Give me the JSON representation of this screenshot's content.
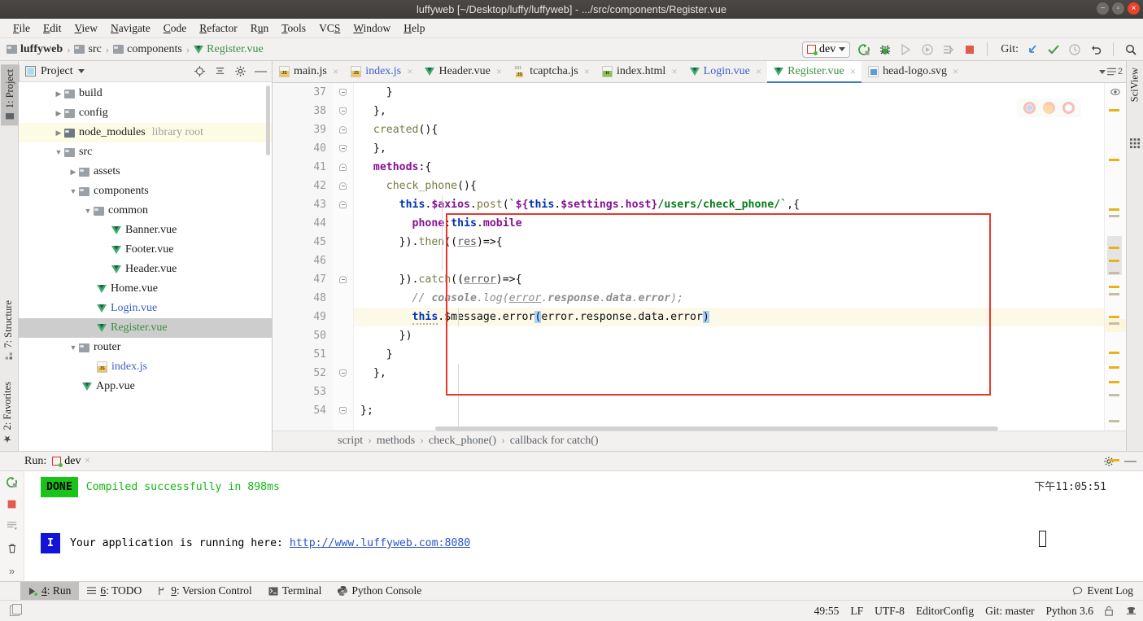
{
  "window": {
    "title": "luffyweb [~/Desktop/luffy/luffyweb] - .../src/components/Register.vue",
    "minimize_label": "–",
    "maximize_label": "□",
    "close_label": "×"
  },
  "menu": {
    "items": [
      "File",
      "Edit",
      "View",
      "Navigate",
      "Code",
      "Refactor",
      "Run",
      "Tools",
      "VCS",
      "Window",
      "Help"
    ]
  },
  "navbar": {
    "breadcrumbs": [
      {
        "label": "luffyweb",
        "icon": "folder-icon",
        "type": "folder",
        "bold": true
      },
      {
        "label": "src",
        "icon": "folder-icon",
        "type": "folder",
        "bold": false
      },
      {
        "label": "components",
        "icon": "folder-icon",
        "type": "folder",
        "bold": false
      },
      {
        "label": "Register.vue",
        "icon": "vue-file-icon",
        "type": "vue",
        "bold": false
      }
    ],
    "run_config": "dev",
    "git_label": "Git:",
    "icons": [
      "rerun-icon",
      "debug-icon",
      "run-with-coverage-icon",
      "profile-icon",
      "step-icon",
      "stop-icon",
      "update-project-icon",
      "commit-icon",
      "history-icon",
      "rollback-icon",
      "search-everywhere-icon"
    ]
  },
  "left_tool_strip": {
    "tabs": [
      {
        "label": "1: Project",
        "selected": true
      },
      {
        "label": "7: Structure",
        "selected": false
      },
      {
        "label": "2: Favorites",
        "selected": false
      }
    ]
  },
  "right_tool_strip": {
    "tabs": [
      {
        "label": "SciView",
        "selected": false
      }
    ]
  },
  "project_panel": {
    "title": "Project",
    "header_icons": [
      "locate-icon",
      "collapse-all-icon",
      "settings-gear-icon",
      "hide-icon"
    ],
    "tree": [
      {
        "label": "build",
        "indent": 1,
        "arrow": "right",
        "icon": "folder-icon",
        "color": "default",
        "state": "normal",
        "sub": ""
      },
      {
        "label": "config",
        "indent": 1,
        "arrow": "right",
        "icon": "folder-icon",
        "color": "default",
        "state": "normal",
        "sub": ""
      },
      {
        "label": "node_modules",
        "indent": 1,
        "arrow": "right",
        "icon": "folder-dark-icon",
        "color": "default",
        "state": "highlight",
        "sub": "library root"
      },
      {
        "label": "src",
        "indent": 1,
        "arrow": "down",
        "icon": "folder-icon",
        "color": "default",
        "state": "normal",
        "sub": ""
      },
      {
        "label": "assets",
        "indent": 2,
        "arrow": "right",
        "icon": "folder-icon",
        "color": "default",
        "state": "normal",
        "sub": ""
      },
      {
        "label": "components",
        "indent": 2,
        "arrow": "down",
        "icon": "folder-icon",
        "color": "default",
        "state": "normal",
        "sub": ""
      },
      {
        "label": "common",
        "indent": 3,
        "arrow": "down",
        "icon": "folder-icon",
        "color": "default",
        "state": "normal",
        "sub": ""
      },
      {
        "label": "Banner.vue",
        "indent": 4,
        "arrow": "none",
        "icon": "vue-file-icon",
        "color": "default",
        "state": "normal",
        "sub": ""
      },
      {
        "label": "Footer.vue",
        "indent": 4,
        "arrow": "none",
        "icon": "vue-file-icon",
        "color": "default",
        "state": "normal",
        "sub": ""
      },
      {
        "label": "Header.vue",
        "indent": 4,
        "arrow": "none",
        "icon": "vue-file-icon",
        "color": "default",
        "state": "normal",
        "sub": ""
      },
      {
        "label": "Home.vue",
        "indent": 3,
        "arrow": "none",
        "icon": "vue-file-icon",
        "color": "default",
        "state": "normal",
        "sub": ""
      },
      {
        "label": "Login.vue",
        "indent": 3,
        "arrow": "none",
        "icon": "vue-file-icon",
        "color": "blue",
        "state": "normal",
        "sub": ""
      },
      {
        "label": "Register.vue",
        "indent": 3,
        "arrow": "none",
        "icon": "vue-file-icon",
        "color": "green",
        "state": "selected",
        "sub": ""
      },
      {
        "label": "router",
        "indent": 2,
        "arrow": "down",
        "icon": "folder-icon",
        "color": "default",
        "state": "normal",
        "sub": ""
      },
      {
        "label": "index.js",
        "indent": 3,
        "arrow": "none",
        "icon": "js-file-icon",
        "color": "blue",
        "state": "normal",
        "sub": ""
      },
      {
        "label": "App.vue",
        "indent": 2,
        "arrow": "none",
        "icon": "vue-file-icon",
        "color": "default",
        "state": "normal",
        "sub": ""
      }
    ]
  },
  "editor_tabs": [
    {
      "label": "main.js",
      "icon": "js-file-icon",
      "color": "default",
      "active": false,
      "close": "×"
    },
    {
      "label": "index.js",
      "icon": "js-file-icon",
      "color": "blue",
      "active": false,
      "close": "×"
    },
    {
      "label": "Header.vue",
      "icon": "vue-file-icon",
      "color": "default",
      "active": false,
      "close": "×"
    },
    {
      "label": "tcaptcha.js",
      "icon": "ts-file-icon",
      "color": "default",
      "active": false,
      "close": "×"
    },
    {
      "label": "index.html",
      "icon": "html-file-icon",
      "color": "default",
      "active": false,
      "close": "×"
    },
    {
      "label": "Login.vue",
      "icon": "vue-file-icon",
      "color": "blue",
      "active": false,
      "close": "×"
    },
    {
      "label": "Register.vue",
      "icon": "vue-file-icon",
      "color": "green",
      "active": true,
      "close": "×"
    },
    {
      "label": "head-logo.svg",
      "icon": "svg-file-icon",
      "color": "default",
      "active": false,
      "close": "×"
    }
  ],
  "editor_tabs_overflow": "2",
  "code": {
    "first_line": 37,
    "highlight_line": 49,
    "lines": [
      {
        "n": 37,
        "fold": "end",
        "text": "    }"
      },
      {
        "n": 38,
        "fold": "end",
        "text": "  },"
      },
      {
        "n": 39,
        "fold": "start",
        "text": "  created(){"
      },
      {
        "n": 40,
        "fold": "end",
        "text": "  },"
      },
      {
        "n": 41,
        "fold": "start",
        "text": "  methods:{"
      },
      {
        "n": 42,
        "fold": "start",
        "text": "    check_phone(){"
      },
      {
        "n": 43,
        "fold": "start",
        "text": "      this.$axios.post(`${this.$settings.host}/users/check_phone/`,{"
      },
      {
        "n": 44,
        "fold": "none",
        "text": "        phone:this.mobile"
      },
      {
        "n": 45,
        "fold": "none",
        "text": "      }).then((res)=>{"
      },
      {
        "n": 46,
        "fold": "none",
        "text": ""
      },
      {
        "n": 47,
        "fold": "start",
        "text": "      }).catch((error)=>{"
      },
      {
        "n": 48,
        "fold": "none",
        "text": "        // console.log(error.response.data.error);"
      },
      {
        "n": 49,
        "fold": "none",
        "text": "        this.$message.error(error.response.data.error)"
      },
      {
        "n": 50,
        "fold": "none",
        "text": "      })"
      },
      {
        "n": 51,
        "fold": "none",
        "text": "    }"
      },
      {
        "n": 52,
        "fold": "end",
        "text": "  },"
      },
      {
        "n": 53,
        "fold": "none",
        "text": ""
      },
      {
        "n": 54,
        "fold": "end",
        "text": "};"
      }
    ]
  },
  "editor_breadcrumb": {
    "items": [
      "script",
      "methods",
      "check_phone()",
      "callback for catch()"
    ],
    "separator": "›"
  },
  "run_panel": {
    "label": "Run:",
    "config": "dev",
    "close": "×",
    "settings_icon": "gear-icon",
    "hide_icon": "hide-icon",
    "timestamp": "下午11:05:51",
    "lines": [
      {
        "badge": "DONE",
        "badge_type": "done",
        "text": "Compiled successfully in 898ms"
      },
      {
        "badge": "I",
        "badge_type": "info",
        "text": "Your application is running here: ",
        "link": "http://www.luffyweb.com:8080"
      }
    ],
    "tool_icons": [
      "rerun-icon",
      "stop-icon",
      "scroll-to-end-icon",
      "trash-icon"
    ]
  },
  "bottom_tool_buttons": [
    {
      "label": "4: Run",
      "icon": "run-icon",
      "active": true
    },
    {
      "label": "6: TODO",
      "icon": "todo-icon",
      "active": false
    },
    {
      "label": "9: Version Control",
      "icon": "branch-icon",
      "active": false
    },
    {
      "label": "Terminal",
      "icon": "terminal-icon",
      "active": false
    },
    {
      "label": "Python Console",
      "icon": "python-icon",
      "active": false
    }
  ],
  "event_log": {
    "label": "Event Log",
    "icon": "balloon-icon"
  },
  "status_bar": {
    "position": "49:55",
    "line_separator": "LF",
    "encoding": "UTF-8",
    "editor_config": "EditorConfig",
    "git_branch": "Git: master",
    "interpreter": "Python 3.6",
    "icons": [
      "lock-icon",
      "inspector-icon"
    ]
  },
  "colors": {
    "accent_blue": "#3d7bbf",
    "vue_green": "#3fae6e",
    "error_red": "#e8382b",
    "done_green": "#19c319",
    "link_blue": "#2a55c9",
    "keyword_blue": "#0033b3",
    "string_green": "#067d17",
    "property_purple": "#871094"
  }
}
